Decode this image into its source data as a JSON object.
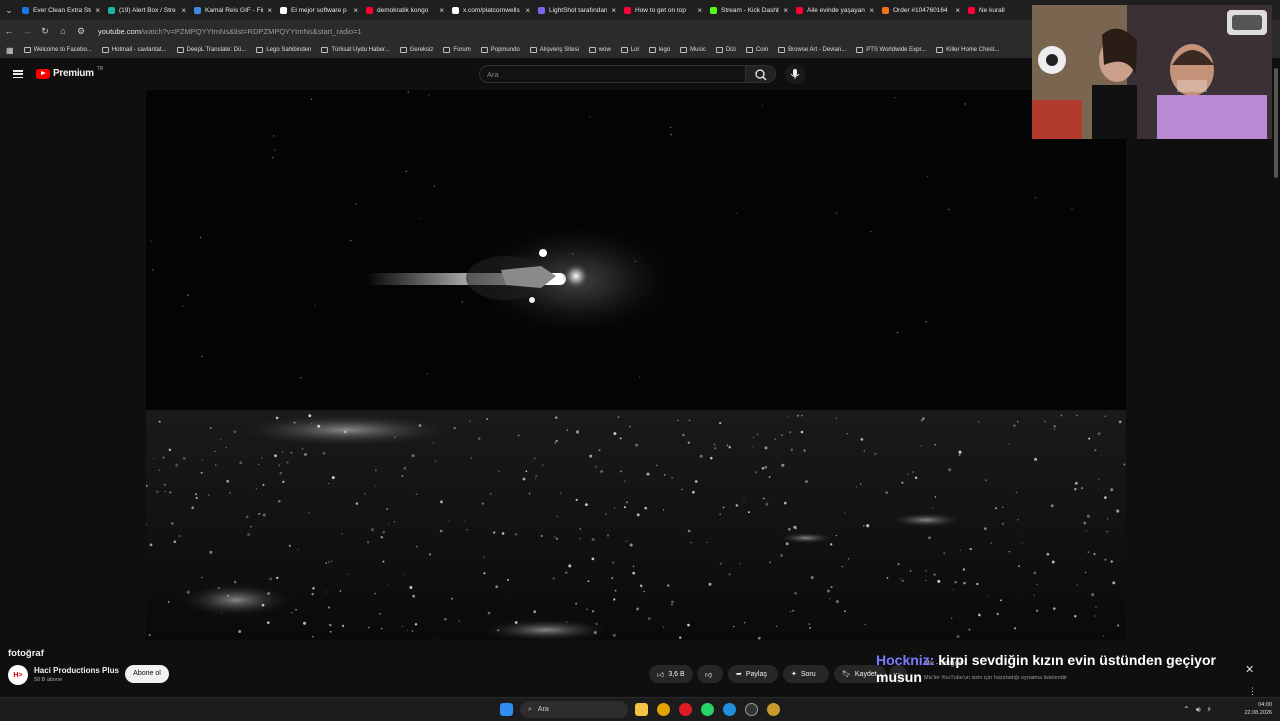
{
  "browser": {
    "tabs": [
      {
        "title": "Ever Clean Extra Str",
        "color": "#1a73e8"
      },
      {
        "title": "(19) Alert Box / Stre",
        "color": "#1bb3a4"
      },
      {
        "title": "Kamal Reis GIF - Fin",
        "color": "#3c8de0"
      },
      {
        "title": "El mejor software p",
        "color": "#ffffff"
      },
      {
        "title": "demokratik kongo",
        "color": "#ff0033"
      },
      {
        "title": "x.com/platcornwells",
        "color": "#ffffff"
      },
      {
        "title": "LightShot tarafından",
        "color": "#7b68ee"
      },
      {
        "title": "How to get on top",
        "color": "#ff0033"
      },
      {
        "title": "Stream - Kick Dashb",
        "color": "#53fc18"
      },
      {
        "title": "Aile evinde yaşayan",
        "color": "#ff0033"
      },
      {
        "title": "Order #104760164",
        "color": "#f2711c"
      },
      {
        "title": "Ne kurall",
        "color": "#ff0033"
      }
    ],
    "url_main": "youtube.com",
    "url_rest": "/watch?v=PZMPQYYtmNs&list=RDPZMPQYYtmNs&start_radio=1",
    "bookmarks": [
      "Welcome to Facebo...",
      "Hotmail - cavlantat...",
      "DeepL Translate: Dü...",
      "Lego Sahibinden",
      "Türksat Uydu Haber...",
      "Gereksiz",
      "Forum",
      "Popmundo",
      "Alışveriş Sitesi",
      "wow",
      "Lol",
      "lego",
      "Music",
      "Dizi",
      "Coin",
      "Browse Art - Devian...",
      "PTS Worldwide Expr...",
      "Killer Home Chest..."
    ]
  },
  "youtube": {
    "logo_text": "Premium",
    "region": "TR",
    "search_placeholder": "Ara"
  },
  "video": {
    "title": "fotoğraf",
    "channel_name": "Haci Productions Plus",
    "subscribers": "50 B abone",
    "subscribe_label": "Abone ol",
    "likes": "3,6 B",
    "share_label": "Paylaş",
    "ask_label": "Soru",
    "save_label": "Kaydet"
  },
  "chat_overlay": {
    "user": "Hockniz:",
    "message": "kirpi sevdiğin kızın evin üstünden geçiyor musun"
  },
  "notification": {
    "line1": "Mix - fotoğraf",
    "line2": "Mix'ler YouTube'un sizin için hazırladığı oynatma listeleridir"
  },
  "taskbar": {
    "search_label": "Ara",
    "time": "04:00",
    "date": "22.08.2026"
  }
}
